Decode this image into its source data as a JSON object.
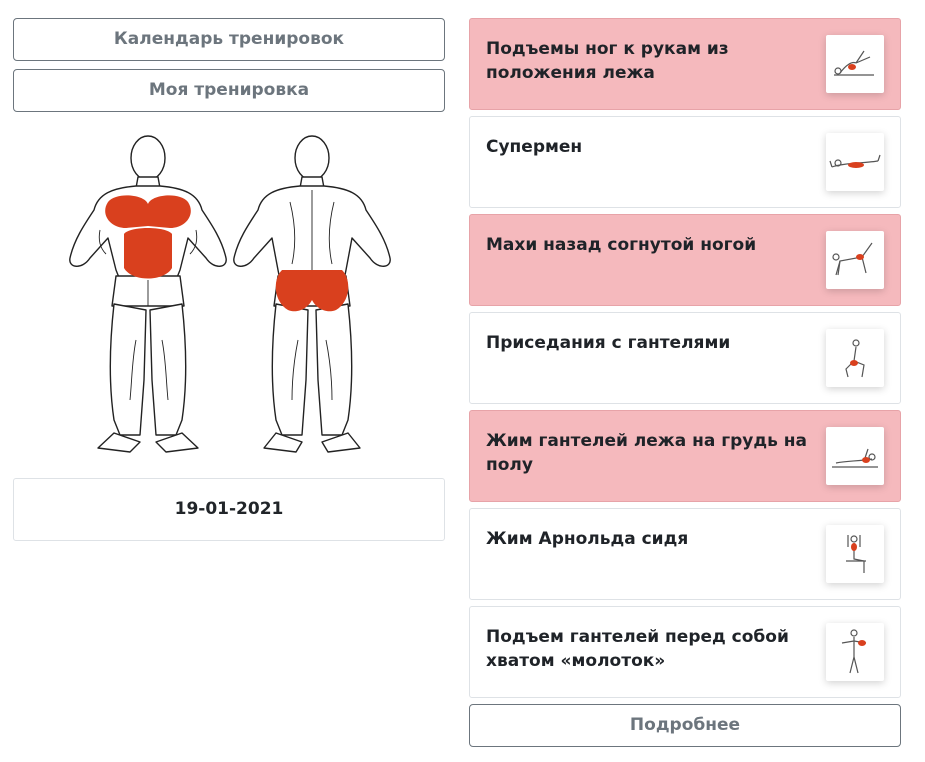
{
  "nav": {
    "calendar_label": "Календарь тренировок",
    "my_workout_label": "Моя тренировка"
  },
  "workout": {
    "date": "19-01-2021"
  },
  "exercises": [
    {
      "title": "Подъемы ног к рукам из положения лежа",
      "highlighted": true,
      "thumb": "leg-raise-icon"
    },
    {
      "title": "Супермен",
      "highlighted": false,
      "thumb": "superman-icon"
    },
    {
      "title": "Махи назад согнутой ногой",
      "highlighted": true,
      "thumb": "kickback-icon"
    },
    {
      "title": "Приседания с гантелями",
      "highlighted": false,
      "thumb": "squat-icon"
    },
    {
      "title": "Жим гантелей лежа на грудь на полу",
      "highlighted": true,
      "thumb": "floor-press-icon"
    },
    {
      "title": "Жим Арнольда сидя",
      "highlighted": false,
      "thumb": "arnold-press-icon"
    },
    {
      "title": "Подъем гантелей перед собой хватом «молоток»",
      "highlighted": false,
      "thumb": "hammer-raise-icon"
    }
  ],
  "more_label": "Подробнее",
  "colors": {
    "highlight_bg": "#f5b9bd",
    "muscle_red": "#d9401e",
    "outline_gray": "#6c757d"
  }
}
